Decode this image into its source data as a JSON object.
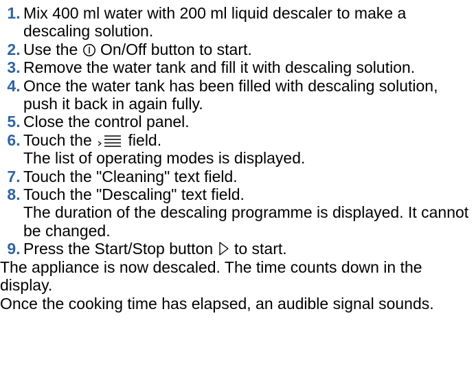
{
  "steps": [
    {
      "num": "1.",
      "text": "Mix 400 ml water with 200 ml liquid descaler to make a descaling solution."
    },
    {
      "num": "2.",
      "before": "Use the",
      "icon": "power-icon",
      "after": "On/Off button to start."
    },
    {
      "num": "3.",
      "text": "Remove the water tank and fill it with descaling solution."
    },
    {
      "num": "4.",
      "text": "Once the water tank has been filled with descaling solution, push it back in again fully."
    },
    {
      "num": "5.",
      "text": "Close the control panel."
    },
    {
      "num": "6.",
      "before": "Touch the",
      "icon": "menu-list-icon",
      "after": "field.",
      "result": "The list of operating modes is displayed."
    },
    {
      "num": "7.",
      "text": "Touch the \"Cleaning\" text field."
    },
    {
      "num": "8.",
      "text": "Touch the \"Descaling\" text field.",
      "result": "The duration of the descaling programme is displayed. It cannot be changed."
    },
    {
      "num": "9.",
      "before": "Press the Start/Stop button",
      "icon": "play-icon",
      "after": "to start."
    }
  ],
  "paragraphs": [
    "The appliance is now descaled. The time counts down in the display.",
    "Once the cooking time has elapsed, an audible signal sounds."
  ],
  "colors": {
    "step_number": "#2f64a3",
    "text": "#000000"
  }
}
